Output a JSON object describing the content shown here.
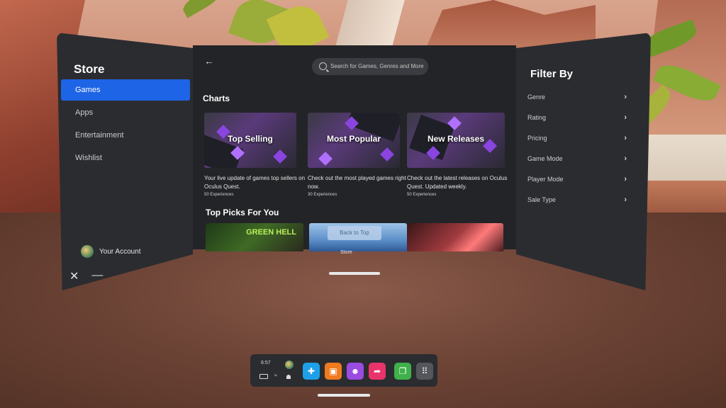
{
  "sidebar": {
    "title": "Store",
    "items": [
      {
        "label": "Games",
        "active": true
      },
      {
        "label": "Apps",
        "active": false
      },
      {
        "label": "Entertainment",
        "active": false
      },
      {
        "label": "Wishlist",
        "active": false
      }
    ],
    "account_label": "Your Account"
  },
  "search": {
    "placeholder": "Search for Games, Genres and More"
  },
  "charts": {
    "title": "Charts",
    "cards": [
      {
        "label": "Top Selling",
        "description": "Your live update of games top sellers on Oculus Quest.",
        "count": "50 Experiences"
      },
      {
        "label": "Most Popular",
        "description": "Check out the most played games right now.",
        "count": "30 Experiences"
      },
      {
        "label": "New Releases",
        "description": "Check out the latest releases on Oculus Quest. Updated weekly.",
        "count": "50 Experiences"
      }
    ]
  },
  "top_picks": {
    "title": "Top Picks For You",
    "game1_title": "GREEN HELL",
    "back_to_top": "Back to Top"
  },
  "filter": {
    "title": "Filter By",
    "items": [
      "Genre",
      "Rating",
      "Pricing",
      "Game Mode",
      "Player Mode",
      "Sale Type"
    ]
  },
  "window": {
    "caption": "Store"
  },
  "dock": {
    "time": "6:57",
    "apps": [
      {
        "icon": "explore-icon",
        "color": "#1ea0e8"
      },
      {
        "icon": "store-icon",
        "color": "#f07a1e"
      },
      {
        "icon": "people-icon",
        "color": "#9a4be0"
      },
      {
        "icon": "share-icon",
        "color": "#e8336b"
      },
      {
        "icon": "media-icon",
        "color": "#3fb04a"
      },
      {
        "icon": "app-library-icon",
        "color": "#55565b"
      }
    ]
  },
  "colors": {
    "accent": "#1e64e6",
    "panel": "#2b2c30",
    "content": "#232427"
  }
}
